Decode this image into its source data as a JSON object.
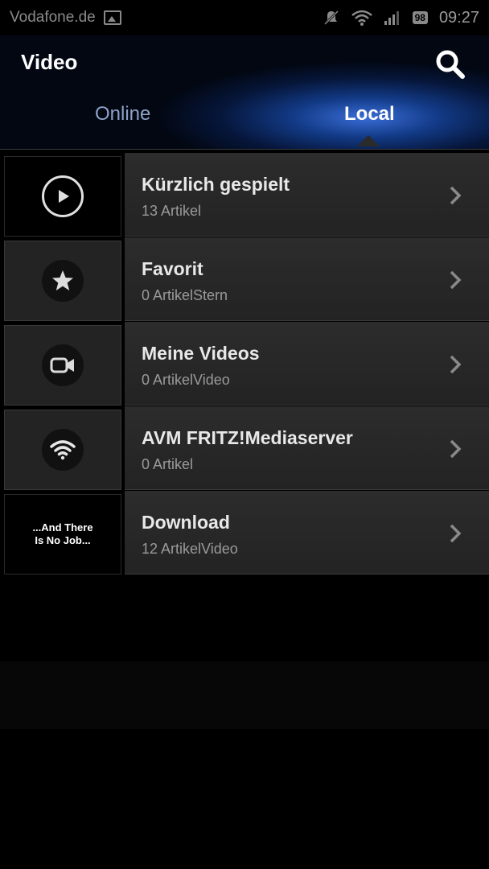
{
  "status_bar": {
    "carrier": "Vodafone.de",
    "battery": "98",
    "time": "09:27",
    "icons": [
      "image-icon",
      "notification-muted-icon",
      "wifi-icon",
      "signal-icon",
      "battery-icon"
    ]
  },
  "header": {
    "title": "Video",
    "search_icon": "search-icon",
    "tabs": [
      {
        "label": "Online",
        "active": false
      },
      {
        "label": "Local",
        "active": true
      }
    ]
  },
  "items": [
    {
      "name": "Kürzlich gespielt",
      "count": "13 Artikel",
      "icon": "play-icon"
    },
    {
      "name": "Favorit",
      "count": "0 ArtikelStern",
      "icon": "star-icon"
    },
    {
      "name": "Meine Videos",
      "count": "0 ArtikelVideo",
      "icon": "video-camera-icon"
    },
    {
      "name": "AVM FRITZ!Mediaserver",
      "count": "0 Artikel",
      "icon": "wifi-icon"
    },
    {
      "name": "Download",
      "count": "12 ArtikelVideo",
      "thumb_text": "...And There Is No Job..."
    }
  ],
  "colors": {
    "accent": "#2f63c9",
    "background": "#000000",
    "row": "#2a2a2a"
  }
}
